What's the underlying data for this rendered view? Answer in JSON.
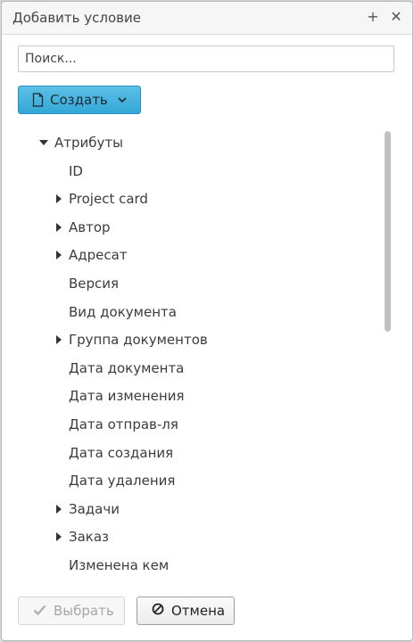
{
  "dialog": {
    "title": "Добавить условие",
    "maximize_glyph": "+",
    "close_glyph": "✕"
  },
  "search": {
    "placeholder": "Поиск...",
    "value": ""
  },
  "create_button": {
    "label": "Создать",
    "icon": "document-icon",
    "dropdown_icon": "chevron-down-icon",
    "color": "#3fb0dd"
  },
  "tree": {
    "root": {
      "label": "Атрибуты",
      "expanded": true
    },
    "items": [
      {
        "label": "ID",
        "expandable": false
      },
      {
        "label": "Project card",
        "expandable": true
      },
      {
        "label": "Автор",
        "expandable": true
      },
      {
        "label": "Адресат",
        "expandable": true
      },
      {
        "label": "Версия",
        "expandable": false
      },
      {
        "label": "Вид документа",
        "expandable": false
      },
      {
        "label": "Группа документов",
        "expandable": true
      },
      {
        "label": "Дата документа",
        "expandable": false
      },
      {
        "label": "Дата изменения",
        "expandable": false
      },
      {
        "label": "Дата отправ-ля",
        "expandable": false
      },
      {
        "label": "Дата создания",
        "expandable": false
      },
      {
        "label": "Дата удаления",
        "expandable": false
      },
      {
        "label": "Задачи",
        "expandable": true
      },
      {
        "label": "Заказ",
        "expandable": true
      },
      {
        "label": "Изменена кем",
        "expandable": false
      }
    ]
  },
  "footer": {
    "select_label": "Выбрать",
    "select_enabled": false,
    "cancel_label": "Отмена"
  }
}
